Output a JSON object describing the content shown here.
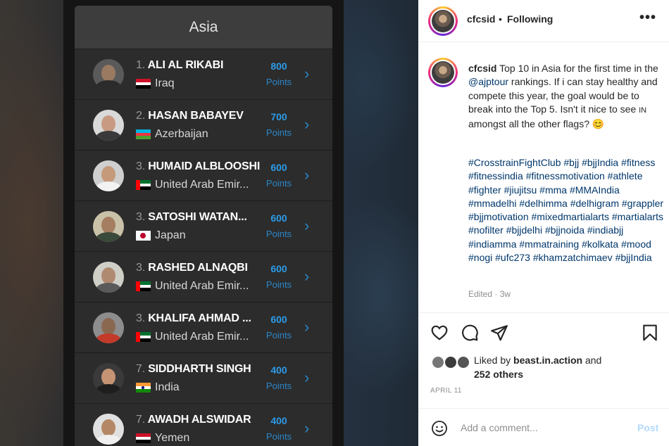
{
  "image": {
    "region_title": "Asia",
    "rankings": [
      {
        "rank": "1.",
        "name": "ALI AL RIKABI",
        "country": "Iraq",
        "points": "800",
        "points_label": "Points",
        "flag": "iraq",
        "skin": "#9b7a62",
        "shirt": "#2b2b2b",
        "bg": "#5a5a5a"
      },
      {
        "rank": "2.",
        "name": "HASAN BABAYEV",
        "country": "Azerbaijan",
        "points": "700",
        "points_label": "Points",
        "flag": "azerbaijan",
        "skin": "#c89a82",
        "shirt": "#3a3a3a",
        "bg": "#d9d9d9"
      },
      {
        "rank": "3.",
        "name": "HUMAID ALBLOOSHI",
        "country": "United Arab Emir...",
        "points": "600",
        "points_label": "Points",
        "flag": "uae",
        "skin": "#c49a7b",
        "shirt": "#f2f2f2",
        "bg": "#cfcfcf"
      },
      {
        "rank": "3.",
        "name": "SATOSHI WATAN...",
        "country": "Japan",
        "points": "600",
        "points_label": "Points",
        "flag": "japan",
        "skin": "#a57d60",
        "shirt": "#3a4a3a",
        "bg": "#c9c2a8"
      },
      {
        "rank": "3.",
        "name": "RASHED ALNAQBI",
        "country": "United Arab Emir...",
        "points": "600",
        "points_label": "Points",
        "flag": "uae",
        "skin": "#b08a70",
        "shirt": "#5a5a5a",
        "bg": "#cfcfc8"
      },
      {
        "rank": "3.",
        "name": "KHALIFA AHMAD ...",
        "country": "United Arab Emir...",
        "points": "600",
        "points_label": "Points",
        "flag": "uae",
        "skin": "#8a6850",
        "shirt": "#c43a2a",
        "bg": "#8d8d8d"
      },
      {
        "rank": "7.",
        "name": "SIDDHARTH SINGH",
        "country": "India",
        "points": "400",
        "points_label": "Points",
        "flag": "india",
        "skin": "#c49474",
        "shirt": "#1e1e1e",
        "bg": "#3a3a3a"
      },
      {
        "rank": "7.",
        "name": "AWADH ALSWIDAR",
        "country": "Yemen",
        "points": "400",
        "points_label": "Points",
        "flag": "yemen",
        "skin": "#b48866",
        "shirt": "#f0f0f0",
        "bg": "#e0e0e0"
      }
    ]
  },
  "post": {
    "username": "cfcsid",
    "dot": "•",
    "follow_status": "Following",
    "more_icon": "more-horizontal-icon",
    "caption_user": "cfcsid",
    "caption_part1": " Top 10 in Asia for the first time in the ",
    "caption_mention": "@ajptour",
    "caption_part2": " rankings. If i can stay healthy and compete this year, the goal would be to break into the Top 5. Isn't it nice to see ",
    "caption_in": "IN",
    "caption_part3": " amongst all the other flags? ",
    "caption_emoji": "😊",
    "hashtags": "#CrosstrainFightClub #bjj #bjjIndia #fitness #fitnessindia #fitnessmotivation #athlete #fighter #jiujitsu #mma #MMAIndia #mmadelhi #delhimma #delhigram #grappler #bjjmotivation #mixedmartialarts #martialarts #nofilter #bjjdelhi #bjjnoida #indiabjj #indiamma #mmatraining #kolkata #mood #nogi #ufc273 #khamzatchimaev #bjjIndia",
    "edited": "Edited · 3w",
    "liked_prefix": "Liked by ",
    "liked_user": "beast.in.action",
    "liked_and": " and",
    "liked_others": "252 others",
    "date": "APRIL 11",
    "comment_placeholder": "Add a comment...",
    "post_button": "Post"
  }
}
